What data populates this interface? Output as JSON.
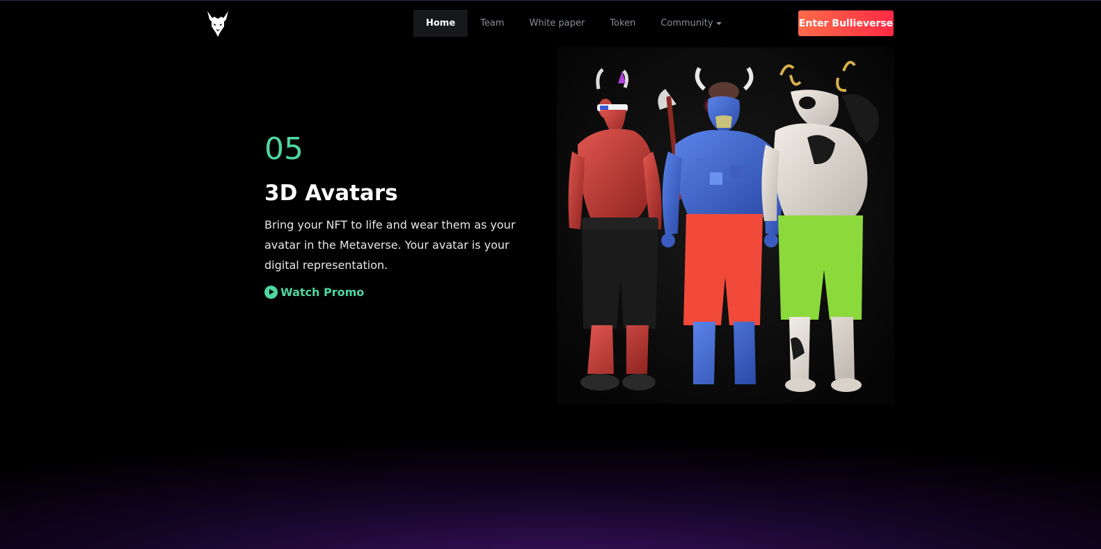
{
  "header": {
    "logo_icon": "bull-head-icon",
    "nav": [
      {
        "label": "Home",
        "active": true
      },
      {
        "label": "Team",
        "active": false
      },
      {
        "label": "White paper",
        "active": false
      },
      {
        "label": "Token",
        "active": false
      },
      {
        "label": "Community",
        "active": false,
        "dropdown": true
      }
    ],
    "cta_label": "Enter Bullieverse"
  },
  "hero": {
    "number": "05",
    "title": "3D Avatars",
    "description": "Bring your NFT to life and wear them as your avatar in the Metaverse. Your avatar is your digital representation.",
    "promo_label": "Watch Promo",
    "promo_icon": "play-circle-icon",
    "image_icon": "avatars-image"
  },
  "colors": {
    "background": "#000000",
    "accent_green": "#4ed7a1",
    "cta_gradient_start": "#ff6b4a",
    "cta_gradient_end": "#ff2a44",
    "bottom_glow": "#481678"
  }
}
